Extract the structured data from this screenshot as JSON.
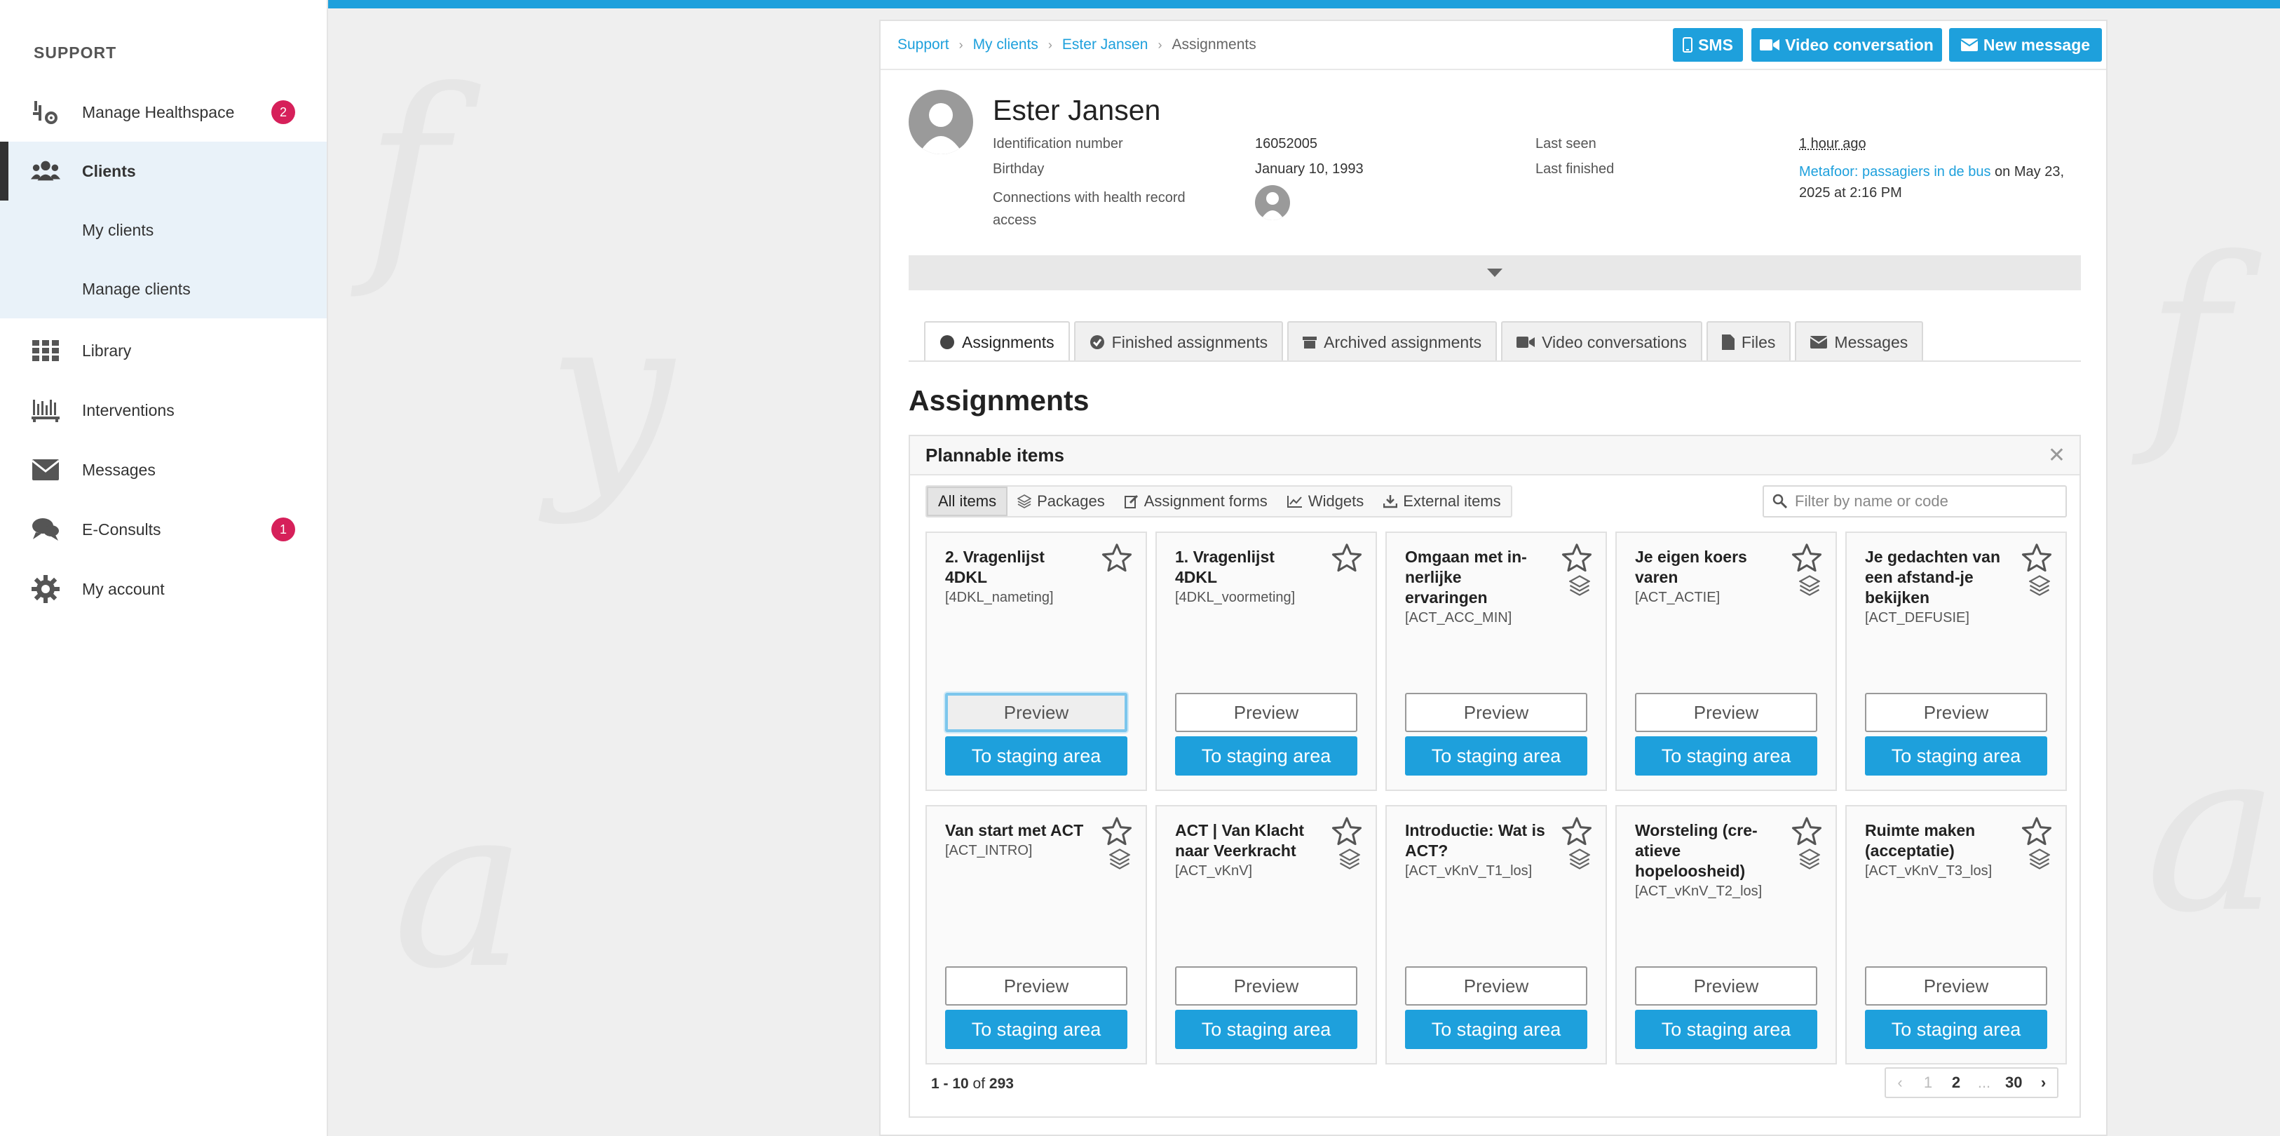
{
  "sidebar": {
    "heading": "SUPPORT",
    "items": [
      {
        "label": "Manage Healthspace",
        "icon": "healthspace-icon",
        "badge": "2"
      },
      {
        "label": "Clients",
        "icon": "users-icon"
      },
      {
        "label": "My clients"
      },
      {
        "label": "Manage clients"
      },
      {
        "label": "Library",
        "icon": "grid-icon"
      },
      {
        "label": "Interventions",
        "icon": "interventions-icon"
      },
      {
        "label": "Messages",
        "icon": "envelope-icon"
      },
      {
        "label": "E-Consults",
        "icon": "chat-icon",
        "badge": "1"
      },
      {
        "label": "My account",
        "icon": "gear-icon"
      }
    ]
  },
  "breadcrumb": {
    "items": [
      "Support",
      "My clients",
      "Ester Jansen"
    ],
    "current": "Assignments"
  },
  "header_buttons": {
    "sms": "SMS",
    "video": "Video conversation",
    "new_message": "New message"
  },
  "client": {
    "name": "Ester Jansen",
    "id_label": "Identification number",
    "id_value": "16052005",
    "birthday_label": "Birthday",
    "birthday_value": "January 10, 1993",
    "connections_label": "Connections with health record access",
    "last_seen_label": "Last seen",
    "last_seen_value": "1 hour ago",
    "last_finished_label": "Last finished",
    "last_finished_link": "Metafoor: passagiers in de bus",
    "last_finished_suffix": " on May 23, 2025 at 2:16 PM"
  },
  "tabs": [
    {
      "label": "Assignments",
      "icon": "circle-icon"
    },
    {
      "label": "Finished assignments",
      "icon": "check-circle-icon"
    },
    {
      "label": "Archived assignments",
      "icon": "archive-icon"
    },
    {
      "label": "Video conversations",
      "icon": "video-icon"
    },
    {
      "label": "Files",
      "icon": "file-icon"
    },
    {
      "label": "Messages",
      "icon": "envelope-icon"
    }
  ],
  "section_title": "Assignments",
  "plannable": {
    "title": "Plannable items",
    "filters": [
      {
        "label": "All items"
      },
      {
        "label": "Packages",
        "icon": "layers-icon"
      },
      {
        "label": "Assignment forms",
        "icon": "form-icon"
      },
      {
        "label": "Widgets",
        "icon": "chart-icon"
      },
      {
        "label": "External items",
        "icon": "download-icon"
      }
    ],
    "search_placeholder": "Filter by name or code",
    "preview_label": "Preview",
    "stage_label": "To staging area",
    "cards": [
      {
        "title": "2. Vragenlijst 4DKL",
        "code": "[4DKL_nameting]",
        "layers": false
      },
      {
        "title": "1. Vragenlijst 4DKL",
        "code": "[4DKL_voormeting]",
        "layers": false
      },
      {
        "title": "Omgaan met in-nerlijke ervaringen",
        "code": "[ACT_ACC_MIN]",
        "layers": true
      },
      {
        "title": "Je eigen koers varen",
        "code": "[ACT_ACTIE]",
        "layers": true
      },
      {
        "title": "Je gedachten van een afstand-je bekijken",
        "code": "[ACT_DEFUSIE]",
        "layers": true
      },
      {
        "title": "Van start met ACT",
        "code": "[ACT_INTRO]",
        "layers": true
      },
      {
        "title": "ACT | Van Klacht naar Veerkracht",
        "code": "[ACT_vKnV]",
        "layers": true
      },
      {
        "title": "Introductie: Wat is ACT?",
        "code": "[ACT_vKnV_T1_los]",
        "layers": true
      },
      {
        "title": "Worsteling (cre-atieve hopeloosheid)",
        "code": "[ACT_vKnV_T2_los]",
        "layers": true
      },
      {
        "title": "Ruimte maken (acceptatie)",
        "code": "[ACT_vKnV_T3_los]",
        "layers": true
      }
    ],
    "paging": {
      "range": "1 - 10",
      "of_label": "of",
      "total": "293",
      "pages": [
        "1",
        "2",
        "...",
        "30"
      ]
    }
  }
}
